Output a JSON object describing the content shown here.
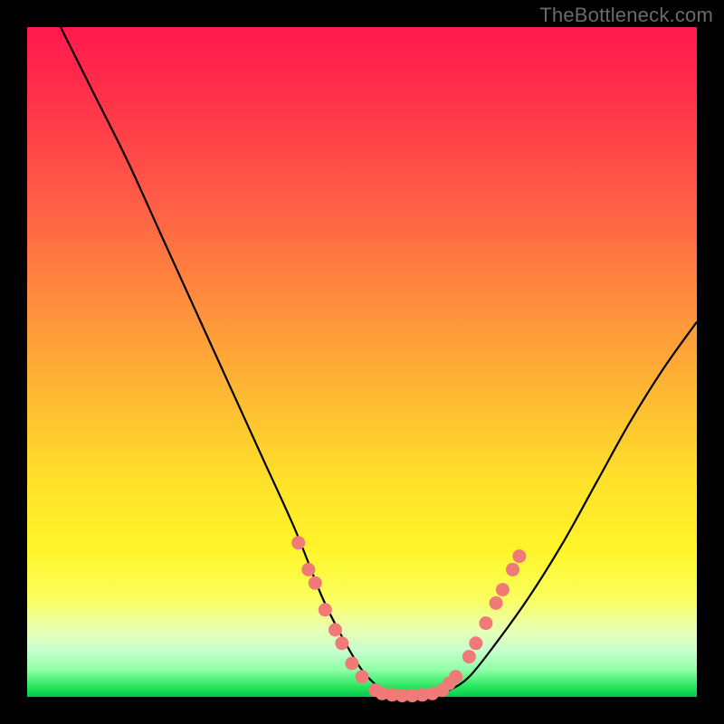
{
  "watermark": "TheBottleneck.com",
  "colors": {
    "frame": "#000000",
    "gradient_top": "#ff1a4d",
    "gradient_mid": "#ffe22a",
    "gradient_bottom": "#00c94a",
    "curve": "#000000",
    "dots": "#ef7a78"
  },
  "chart_data": {
    "type": "line",
    "title": "",
    "xlabel": "",
    "ylabel": "",
    "xlim": [
      0,
      100
    ],
    "ylim": [
      0,
      100
    ],
    "legend": false,
    "grid": false,
    "series": [
      {
        "name": "bottleneck-curve",
        "x": [
          5,
          10,
          15,
          20,
          25,
          30,
          35,
          40,
          44,
          47,
          50,
          53,
          55,
          58,
          60,
          63,
          66,
          70,
          75,
          80,
          85,
          90,
          95,
          100
        ],
        "y": [
          100,
          90,
          80,
          69,
          58,
          47,
          36,
          25,
          15,
          9,
          4,
          1,
          0,
          0,
          0,
          1,
          3,
          8,
          15,
          23,
          32,
          41,
          49,
          56
        ]
      }
    ],
    "markers": [
      {
        "x": 40.5,
        "y": 23
      },
      {
        "x": 42.0,
        "y": 19
      },
      {
        "x": 43.0,
        "y": 17
      },
      {
        "x": 44.5,
        "y": 13
      },
      {
        "x": 46.0,
        "y": 10
      },
      {
        "x": 47.0,
        "y": 8
      },
      {
        "x": 48.5,
        "y": 5
      },
      {
        "x": 50.0,
        "y": 3
      },
      {
        "x": 52.0,
        "y": 1
      },
      {
        "x": 53.0,
        "y": 0.5
      },
      {
        "x": 54.5,
        "y": 0.3
      },
      {
        "x": 56.0,
        "y": 0.2
      },
      {
        "x": 57.5,
        "y": 0.2
      },
      {
        "x": 59.0,
        "y": 0.3
      },
      {
        "x": 60.5,
        "y": 0.5
      },
      {
        "x": 62.0,
        "y": 1
      },
      {
        "x": 63.0,
        "y": 2
      },
      {
        "x": 64.0,
        "y": 3
      },
      {
        "x": 66.0,
        "y": 6
      },
      {
        "x": 67.0,
        "y": 8
      },
      {
        "x": 68.5,
        "y": 11
      },
      {
        "x": 70.0,
        "y": 14
      },
      {
        "x": 71.0,
        "y": 16
      },
      {
        "x": 72.5,
        "y": 19
      },
      {
        "x": 73.5,
        "y": 21
      }
    ]
  }
}
